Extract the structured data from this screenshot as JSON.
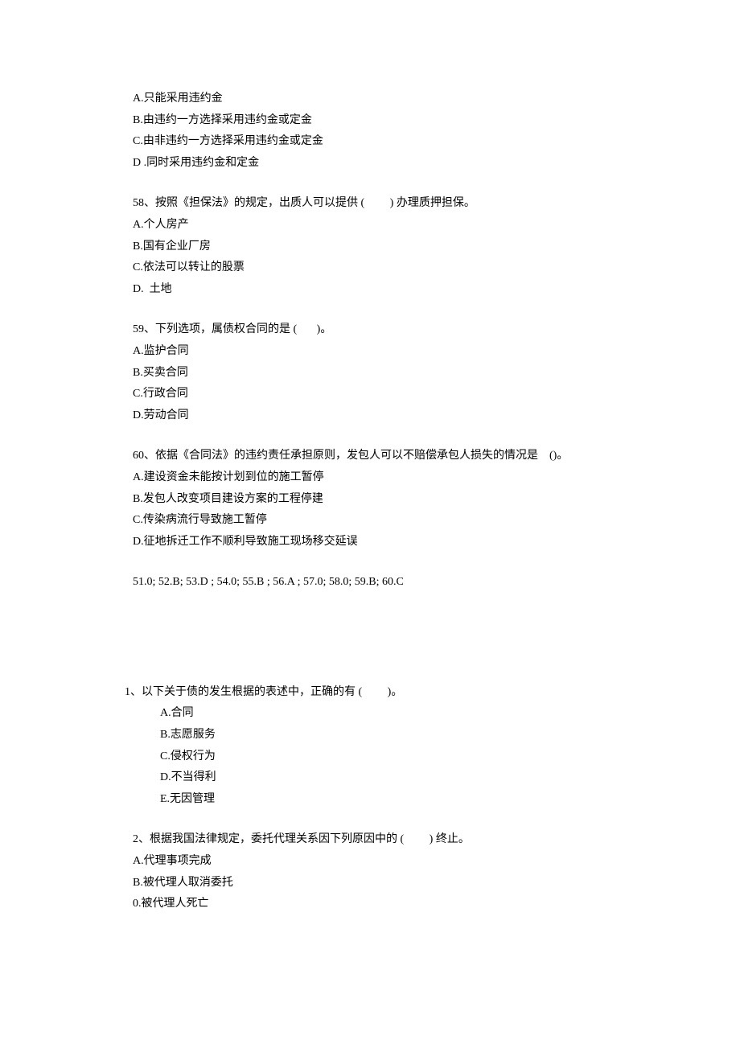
{
  "continuation_options": {
    "a": "A.只能采用违约金",
    "b": "B.由违约一方选择采用违约金或定金",
    "c": "C.由非违约一方选择采用违约金或定金",
    "d": "D .同时采用违约金和定金"
  },
  "q58": {
    "stem": "58、按照《担保法》的规定，出质人可以提供 (         ) 办理质押担保。",
    "a": "A.个人房产",
    "b": "B.国有企业厂房",
    "c": "C.依法可以转让的股票",
    "d": "D.  土地"
  },
  "q59": {
    "stem": "59、下列选项，属债权合同的是 (       )。",
    "a": "A.监护合同",
    "b": "B.买卖合同",
    "c": "C.行政合同",
    "d": "D.劳动合同"
  },
  "q60": {
    "stem": "60、依据《合同法》的违约责任承担原则，发包人可以不赔偿承包人损失的情况是    ()。",
    "a": "A.建设资金未能按计划到位的施工暂停",
    "b": "B.发包人改变项目建设方案的工程停建",
    "c": "C.传染病流行导致施工暂停",
    "d": "D.征地拆迁工作不顺利导致施工现场移交延误"
  },
  "answers_line": "51.0; 52.B; 53.D ; 54.0; 55.B ; 56.A ; 57.0; 58.0; 59.B; 60.C",
  "mq1": {
    "stem": "1、以下关于债的发生根据的表述中，正确的有 (         )。",
    "a": "A.合同",
    "b": "B.志愿服务",
    "c": "C.侵权行为",
    "d": "D.不当得利",
    "e": "E.无因管理"
  },
  "mq2": {
    "stem": "2、根据我国法律规定，委托代理关系因下列原因中的 (         ) 终止。",
    "a": "A.代理事项完成",
    "b": "B.被代理人取消委托",
    "c": "0.被代理人死亡"
  }
}
